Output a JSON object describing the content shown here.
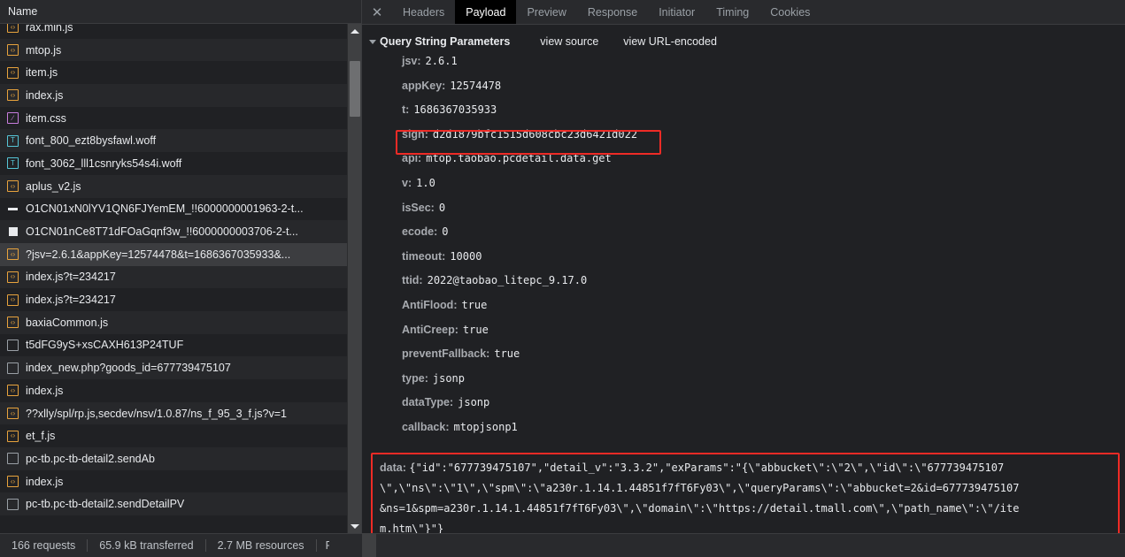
{
  "left_panel": {
    "column_header": "Name",
    "requests": [
      {
        "name": "rax.min.js",
        "icon": "js-file-icon",
        "selected": false,
        "clipped_top": true
      },
      {
        "name": "mtop.js",
        "icon": "js-file-icon",
        "selected": false
      },
      {
        "name": "item.js",
        "icon": "js-file-icon",
        "selected": false
      },
      {
        "name": "index.js",
        "icon": "js-file-icon",
        "selected": false
      },
      {
        "name": "item.css",
        "icon": "css-file-icon",
        "selected": false
      },
      {
        "name": "font_800_ezt8bysfawl.woff",
        "icon": "font-file-icon",
        "selected": false
      },
      {
        "name": "font_3062_lll1csnryks54s4i.woff",
        "icon": "font-file-icon",
        "selected": false
      },
      {
        "name": "aplus_v2.js",
        "icon": "js-file-icon",
        "selected": false
      },
      {
        "name": "O1CN01xN0lYV1QN6FJYemEM_!!6000000001963-2-t...",
        "icon": "image-line-icon",
        "selected": false
      },
      {
        "name": "O1CN01nCe8T71dFOaGqnf3w_!!6000000003706-2-t...",
        "icon": "image-box-icon",
        "selected": false
      },
      {
        "name": "?jsv=2.6.1&appKey=12574478&t=1686367035933&...",
        "icon": "js-file-icon",
        "selected": true
      },
      {
        "name": "index.js?t=234217",
        "icon": "js-file-icon",
        "selected": false
      },
      {
        "name": "index.js?t=234217",
        "icon": "js-file-icon",
        "selected": false
      },
      {
        "name": "baxiaCommon.js",
        "icon": "js-file-icon",
        "selected": false
      },
      {
        "name": "t5dFG9yS+xsCAXH613P24TUF",
        "icon": "doc-file-icon",
        "selected": false
      },
      {
        "name": "index_new.php?goods_id=677739475107",
        "icon": "doc-file-icon",
        "selected": false
      },
      {
        "name": "index.js",
        "icon": "js-file-icon",
        "selected": false
      },
      {
        "name": "??xlly/spl/rp.js,secdev/nsv/1.0.87/ns_f_95_3_f.js?v=1",
        "icon": "js-file-icon",
        "selected": false
      },
      {
        "name": "et_f.js",
        "icon": "js-file-icon",
        "selected": false
      },
      {
        "name": "pc-tb.pc-tb-detail2.sendAb",
        "icon": "doc-file-icon",
        "selected": false
      },
      {
        "name": "index.js",
        "icon": "js-file-icon",
        "selected": false
      },
      {
        "name": "pc-tb.pc-tb-detail2.sendDetailPV",
        "icon": "doc-file-icon",
        "selected": false
      }
    ],
    "scrollbar": {
      "up_arrow": "scroll-up-arrow-icon",
      "down_arrow": "scroll-down-arrow-icon"
    }
  },
  "detail_panel": {
    "close_label": "✕",
    "tabs": [
      {
        "label": "Headers",
        "active": false
      },
      {
        "label": "Payload",
        "active": true
      },
      {
        "label": "Preview",
        "active": false
      },
      {
        "label": "Response",
        "active": false
      },
      {
        "label": "Initiator",
        "active": false
      },
      {
        "label": "Timing",
        "active": false
      },
      {
        "label": "Cookies",
        "active": false
      }
    ],
    "section": {
      "title": "Query String Parameters",
      "view_source_label": "view source",
      "view_url_encoded_label": "view URL-encoded"
    },
    "parameters": [
      {
        "key": "jsv:",
        "value": "2.6.1",
        "highlighted": false
      },
      {
        "key": "appKey:",
        "value": "12574478",
        "highlighted": false
      },
      {
        "key": "t:",
        "value": "1686367035933",
        "highlighted": false
      },
      {
        "key": "sign:",
        "value": "d2d1879bfc1515d608cbc23d6421d022",
        "highlighted": true
      },
      {
        "key": "api:",
        "value": "mtop.taobao.pcdetail.data.get",
        "highlighted": false
      },
      {
        "key": "v:",
        "value": "1.0",
        "highlighted": false
      },
      {
        "key": "isSec:",
        "value": "0",
        "highlighted": false
      },
      {
        "key": "ecode:",
        "value": "0",
        "highlighted": false
      },
      {
        "key": "timeout:",
        "value": "10000",
        "highlighted": false
      },
      {
        "key": "ttid:",
        "value": "2022@taobao_litepc_9.17.0",
        "highlighted": false
      },
      {
        "key": "AntiFlood:",
        "value": "true",
        "highlighted": false
      },
      {
        "key": "AntiCreep:",
        "value": "true",
        "highlighted": false
      },
      {
        "key": "preventFallback:",
        "value": "true",
        "highlighted": false
      },
      {
        "key": "type:",
        "value": "jsonp",
        "highlighted": false
      },
      {
        "key": "dataType:",
        "value": "jsonp",
        "highlighted": false
      },
      {
        "key": "callback:",
        "value": "mtopjsonp1",
        "highlighted": false
      }
    ],
    "data_param": {
      "key": "data:",
      "lines": [
        "{\"id\":\"677739475107\",\"detail_v\":\"3.3.2\",\"exParams\":\"{\\\"abbucket\\\":\\\"2\\\",\\\"id\\\":\\\"677739475107",
        "\\\",\\\"ns\\\":\\\"1\\\",\\\"spm\\\":\\\"a230r.1.14.1.44851f7fT6Fy03\\\",\\\"queryParams\\\":\\\"abbucket=2&id=677739475107",
        "&ns=1&spm=a230r.1.14.1.44851f7fT6Fy03\\\",\\\"domain\\\":\\\"https://detail.tmall.com\\\",\\\"path_name\\\":\\\"/ite",
        "m.htm\\\"}\"}"
      ]
    }
  },
  "status_bar": {
    "requests": "166 requests",
    "transferred": "65.9 kB transferred",
    "resources": "2.7 MB resources",
    "finish": "F"
  },
  "colors": {
    "background": "#202124",
    "panel_header": "#292a2d",
    "row_alt": "#27282b",
    "row_selected": "#3c3d40",
    "text": "#e8eaed",
    "text_dim": "#9aa0a6",
    "key_color": "#a8abb0",
    "highlight_box": "#ee2b26",
    "js_icon": "#e8a33d",
    "css_icon": "#c77dde",
    "font_icon": "#56c5d6",
    "scrollbar_track": "#3f4042",
    "scrollbar_thumb": "#6e6f71",
    "active_tab_bg": "#000000"
  }
}
